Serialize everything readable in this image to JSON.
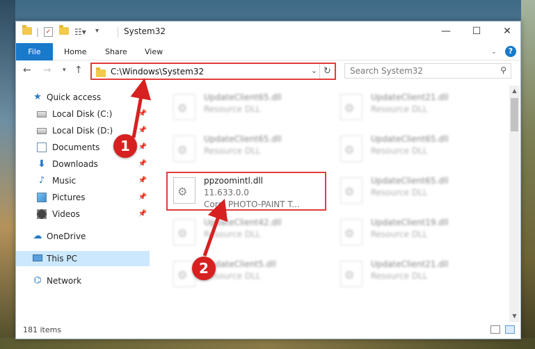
{
  "window": {
    "title": "System32",
    "controls": {
      "minimize": "—",
      "maximize": "☐",
      "close": "✕"
    }
  },
  "ribbon": {
    "tabs": [
      "File",
      "Home",
      "Share",
      "View"
    ],
    "help": "?"
  },
  "navigation": {
    "address": "C:\\Windows\\System32",
    "search_placeholder": "Search System32"
  },
  "sidebar": {
    "quick_access": "Quick access",
    "quick_items": [
      "Local Disk (C:)",
      "Local Disk (D:)",
      "Documents",
      "Downloads",
      "Music",
      "Pictures",
      "Videos"
    ],
    "onedrive": "OneDrive",
    "this_pc": "This PC",
    "network": "Network"
  },
  "files": [
    {
      "name": "UpdateClient65.dll",
      "desc": "Resource DLL"
    },
    {
      "name": "UpdateClient21.dll",
      "desc": "Resource DLL"
    },
    {
      "name": "UpdateClient65.dll",
      "desc": "Resource DLL"
    },
    {
      "name": "UpdateClient65.dll",
      "desc": "Resource DLL"
    },
    {
      "name": "ppzoomintl.dll",
      "version": "11.633.0.0",
      "desc": "Corel PHOTO-PAINT T..."
    },
    {
      "name": "UpdateClient65.dll",
      "desc": "Resource DLL"
    },
    {
      "name": "UpdateClient42.dll",
      "desc": "Resource DLL"
    },
    {
      "name": "UpdateClient19.dll",
      "desc": "Resource DLL"
    },
    {
      "name": "UpdateClient5.dll",
      "desc": "Resource DLL"
    },
    {
      "name": "UpdateClient21.dll",
      "desc": "Resource DLL"
    }
  ],
  "status": {
    "item_count": "181 items"
  },
  "annotations": {
    "step1": "1",
    "step2": "2"
  },
  "colors": {
    "accent": "#1979ca",
    "highlight": "#e23b3b",
    "callout": "#d72020",
    "selected": "#cce8ff"
  }
}
